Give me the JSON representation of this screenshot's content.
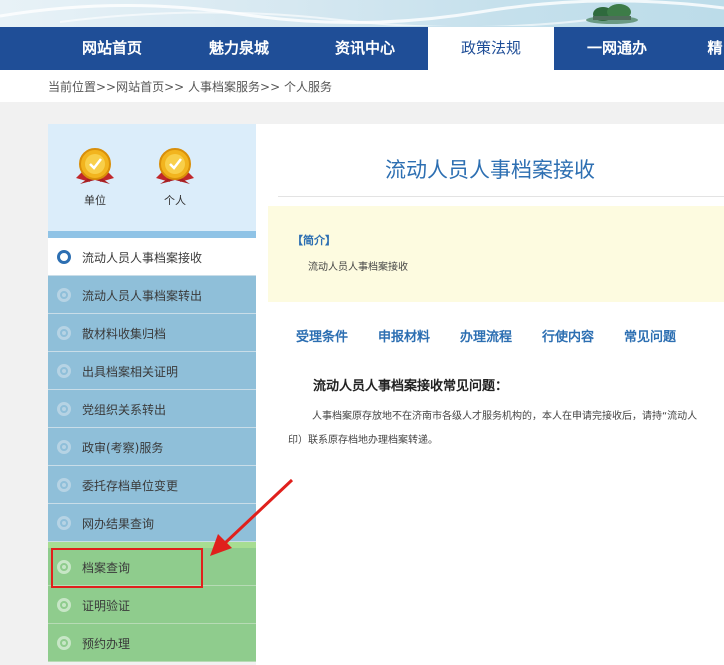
{
  "nav": {
    "items": [
      {
        "label": "网站首页"
      },
      {
        "label": "魅力泉城"
      },
      {
        "label": "资讯中心"
      },
      {
        "label": "政策法规"
      },
      {
        "label": "一网通办"
      },
      {
        "label": "精"
      }
    ],
    "active_index": 3
  },
  "breadcrumb": "当前位置>>网站首页>> 人事档案服务>> 个人服务",
  "sidebar": {
    "medals": [
      {
        "label": "单位"
      },
      {
        "label": "个人"
      }
    ],
    "items": [
      {
        "label": "流动人员人事档案接收"
      },
      {
        "label": "流动人员人事档案转出"
      },
      {
        "label": "散材料收集归档"
      },
      {
        "label": "出具档案相关证明"
      },
      {
        "label": "党组织关系转出"
      },
      {
        "label": "政审(考察)服务"
      },
      {
        "label": "委托存档单位变更"
      },
      {
        "label": "网办结果查询"
      },
      {
        "label": "档案查询"
      },
      {
        "label": "证明验证"
      },
      {
        "label": "预约办理"
      }
    ]
  },
  "main": {
    "title": "流动人员人事档案接收",
    "intro_heading": "【简介】",
    "intro_text": "流动人员人事档案接收",
    "tabs": [
      {
        "label": "受理条件"
      },
      {
        "label": "申报材料"
      },
      {
        "label": "办理流程"
      },
      {
        "label": "行使内容"
      },
      {
        "label": "常见问题"
      }
    ],
    "faq_title": "流动人员人事档案接收常见问题：",
    "faq_line1": "人事档案原存放地不在济南市各级人才服务机构的，本人在申请完接收后，请持“流动人",
    "faq_line2": "印）联系原存档地办理档案转递。"
  },
  "colors": {
    "nav_bg": "#1f4e97",
    "accent_blue": "#2d6fb2",
    "sidebar_blue": "#8fbfd9",
    "sidebar_green": "#8fcc8d",
    "highlight_red": "#e0201c"
  },
  "icons": {
    "medal": "gold-medal-icon",
    "ring": "circle-bullet-icon",
    "annotation": "red-arrow-icon"
  }
}
